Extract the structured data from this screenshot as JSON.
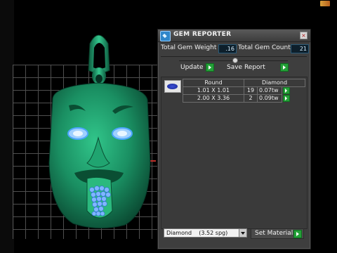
{
  "app": {
    "title": "GEM REPORTER",
    "close_glyph": "×"
  },
  "totals": {
    "weight_label": "Total Gem Weight",
    "weight_value": ".16",
    "count_label": "Total Gem Count",
    "count_value": "21"
  },
  "actions": {
    "update_label": "Update",
    "save_report_label": "Save Report",
    "set_material_label": "Set Material"
  },
  "gem_table": {
    "shape_header": "Round",
    "material_header": "Diamond",
    "rows": [
      {
        "size": "1.01 X 1.01",
        "count": "19",
        "weight": "0.07tw"
      },
      {
        "size": "2.00 X 3.36",
        "count": "2",
        "weight": "0.09tw"
      }
    ]
  },
  "material_select": {
    "value": "Diamond    (3.52 spg)"
  },
  "colors": {
    "accent_green": "#24a038",
    "model_green": "#1b8f62",
    "gem_blue": "#7fb6ff"
  },
  "icons": [
    "gem-reporter-icon",
    "close-icon",
    "gem-shape-icon",
    "play-arrow-icon",
    "dropdown-arrow-icon"
  ]
}
